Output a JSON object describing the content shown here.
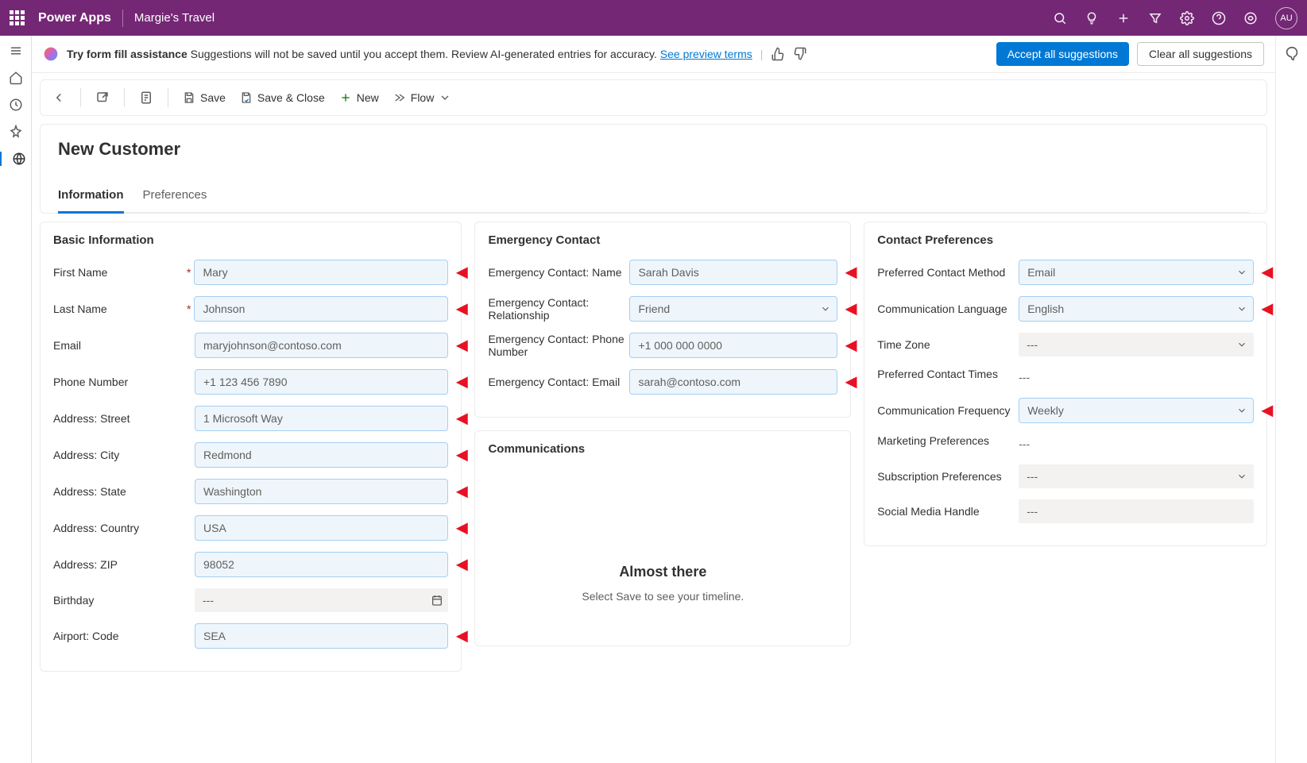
{
  "topbar": {
    "brand": "Power Apps",
    "env": "Margie's Travel",
    "avatar": "AU"
  },
  "banner": {
    "bold": "Try form fill assistance",
    "text": " Suggestions will not be saved until you accept them. Review AI-generated entries for accuracy. ",
    "link": "See preview terms",
    "accept_btn": "Accept all suggestions",
    "clear_btn": "Clear all suggestions"
  },
  "cmdbar": {
    "save": "Save",
    "save_close": "Save & Close",
    "new": "New",
    "flow": "Flow"
  },
  "page": {
    "title": "New Customer",
    "tab_info": "Information",
    "tab_pref": "Preferences"
  },
  "sections": {
    "basic": "Basic Information",
    "emergency": "Emergency Contact",
    "comms": "Communications",
    "prefs": "Contact Preferences"
  },
  "basic": {
    "first_name": {
      "label": "First Name",
      "value": "Mary"
    },
    "last_name": {
      "label": "Last Name",
      "value": "Johnson"
    },
    "email": {
      "label": "Email",
      "value": "maryjohnson@contoso.com"
    },
    "phone": {
      "label": "Phone Number",
      "value": "+1 123 456 7890"
    },
    "street": {
      "label": "Address: Street",
      "value": "1 Microsoft Way"
    },
    "city": {
      "label": "Address: City",
      "value": "Redmond"
    },
    "state": {
      "label": "Address: State",
      "value": "Washington"
    },
    "country": {
      "label": "Address: Country",
      "value": "USA"
    },
    "zip": {
      "label": "Address: ZIP",
      "value": "98052"
    },
    "birthday": {
      "label": "Birthday",
      "value": "---"
    },
    "airport": {
      "label": "Airport: Code",
      "value": "SEA"
    }
  },
  "emergency": {
    "name": {
      "label": "Emergency Contact: Name",
      "value": "Sarah Davis"
    },
    "rel": {
      "label": "Emergency Contact: Relationship",
      "value": "Friend"
    },
    "phone": {
      "label": "Emergency Contact: Phone Number",
      "value": "+1 000 000 0000"
    },
    "email": {
      "label": "Emergency Contact: Email",
      "value": "sarah@contoso.com"
    }
  },
  "prefs": {
    "method": {
      "label": "Preferred Contact Method",
      "value": "Email"
    },
    "lang": {
      "label": "Communication Language",
      "value": "English"
    },
    "tz": {
      "label": "Time Zone",
      "value": "---"
    },
    "times": {
      "label": "Preferred Contact Times",
      "value": "---"
    },
    "freq": {
      "label": "Communication Frequency",
      "value": "Weekly"
    },
    "marketing": {
      "label": "Marketing Preferences",
      "value": "---"
    },
    "subs": {
      "label": "Subscription Preferences",
      "value": "---"
    },
    "social": {
      "label": "Social Media Handle",
      "value": "---"
    }
  },
  "timeline": {
    "title": "Almost there",
    "text": "Select Save to see your timeline."
  }
}
